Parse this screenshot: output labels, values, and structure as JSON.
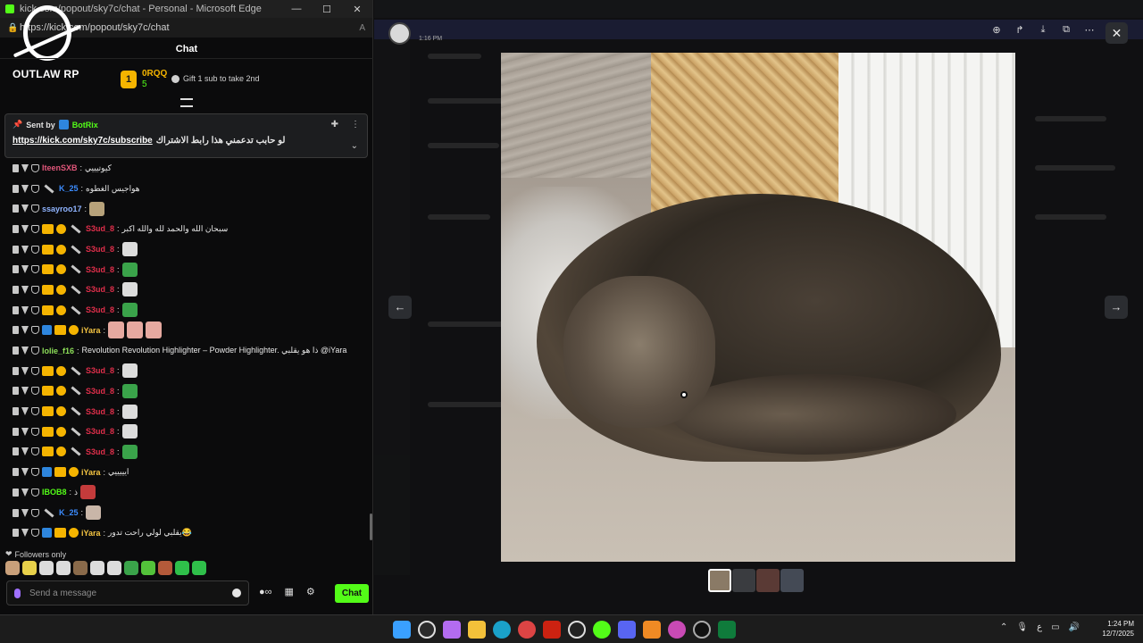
{
  "edge": {
    "title": "kick.com/popout/sky7c/chat - Personal - Microsoft Edge",
    "url": "https://kick.com/popout/sky7c/chat",
    "minimize": "—",
    "maximize": "☐",
    "close": "✕"
  },
  "logo": {
    "text": "OUTLAW RP"
  },
  "chat": {
    "header": "Chat",
    "top_gifter": {
      "rank": "1",
      "name": "0RQQ",
      "count": "5"
    },
    "gift_note": "Gift 1 sub to take 2nd",
    "pinned": {
      "sent_by": "Sent by",
      "sender": "BotRix",
      "link": "https://kick.com/sky7c/subscribe",
      "text": "لو حابب تدعمني هذا رابط الاشتراك"
    },
    "messages": [
      {
        "user": "IteenSXB",
        "color": "#e0567a",
        "text": "كيوتيييي",
        "badges": []
      },
      {
        "user": "K_25",
        "color": "#3c8cff",
        "text": "هواجيس الغطوه",
        "badges": [
          "sword"
        ]
      },
      {
        "user": "ssayroo17",
        "color": "#8fb4ff",
        "text": "",
        "badges": [],
        "emote": "#b7a27a"
      },
      {
        "user": "S3ud_8",
        "color": "#e02f4b",
        "text": "سبحان الله والحمد لله والله اكبر",
        "badges": [
          "crown",
          "sub",
          "sword"
        ]
      },
      {
        "user": "S3ud_8",
        "color": "#e02f4b",
        "text": "",
        "badges": [
          "crown",
          "sub",
          "sword"
        ],
        "emote": "#dcdcdc"
      },
      {
        "user": "S3ud_8",
        "color": "#e02f4b",
        "text": "",
        "badges": [
          "crown",
          "sub",
          "sword"
        ],
        "emote": "#3aa34a"
      },
      {
        "user": "S3ud_8",
        "color": "#e02f4b",
        "text": "",
        "badges": [
          "crown",
          "sub",
          "sword"
        ],
        "emote": "#dcdcdc"
      },
      {
        "user": "S3ud_8",
        "color": "#e02f4b",
        "text": "",
        "badges": [
          "crown",
          "sub",
          "sword"
        ],
        "emote": "#3aa34a"
      },
      {
        "user": "iYara",
        "color": "#f5c542",
        "text": "",
        "badges": [
          "og",
          "crown",
          "sub"
        ],
        "emote": "#e6a9a0",
        "emote_count": 3
      },
      {
        "user": "lolie_f16",
        "color": "#8ee05a",
        "text": "Revolution Revolution Highlighter – Powder Highlighter. ذا هو يقلبي @iYara",
        "badges": []
      },
      {
        "user": "S3ud_8",
        "color": "#e02f4b",
        "text": "",
        "badges": [
          "crown",
          "sub",
          "sword"
        ],
        "emote": "#dcdcdc"
      },
      {
        "user": "S3ud_8",
        "color": "#e02f4b",
        "text": "",
        "badges": [
          "crown",
          "sub",
          "sword"
        ],
        "emote": "#3aa34a"
      },
      {
        "user": "S3ud_8",
        "color": "#e02f4b",
        "text": "",
        "badges": [
          "crown",
          "sub",
          "sword"
        ],
        "emote": "#dcdcdc"
      },
      {
        "user": "S3ud_8",
        "color": "#e02f4b",
        "text": "",
        "badges": [
          "crown",
          "sub",
          "sword"
        ],
        "emote": "#dcdcdc"
      },
      {
        "user": "S3ud_8",
        "color": "#e02f4b",
        "text": "",
        "badges": [
          "crown",
          "sub",
          "sword"
        ],
        "emote": "#3aa34a"
      },
      {
        "user": "iYara",
        "color": "#f5c542",
        "text": "ايييييي",
        "badges": [
          "og",
          "crown",
          "sub"
        ]
      },
      {
        "user": "IBOB8",
        "color": "#53fc18",
        "text": "ذ",
        "badges": [],
        "emote": "#c43b3b"
      },
      {
        "user": "K_25",
        "color": "#3c8cff",
        "text": "",
        "badges": [
          "sword"
        ],
        "emote": "#c9b6a8"
      },
      {
        "user": "iYara",
        "color": "#f5c542",
        "text": "يقلبي لولي راحت تدور😂",
        "badges": [
          "og",
          "crown",
          "sub"
        ]
      }
    ],
    "followers_only": "Followers only",
    "input_placeholder": "Send a message",
    "send_label": "Chat"
  },
  "viewer": {
    "time": "1:16 PM",
    "prev": "←",
    "next": "→",
    "close": "✕",
    "tools": [
      "zoom-in-icon",
      "forward-icon",
      "download-icon",
      "open-external-icon",
      "more-icon"
    ]
  },
  "taskbar": {
    "time": "1:24 PM",
    "date": "12/7/2025",
    "lang": "ع"
  },
  "colors": {
    "kick_green": "#53fc18",
    "gold": "#f5b400"
  }
}
